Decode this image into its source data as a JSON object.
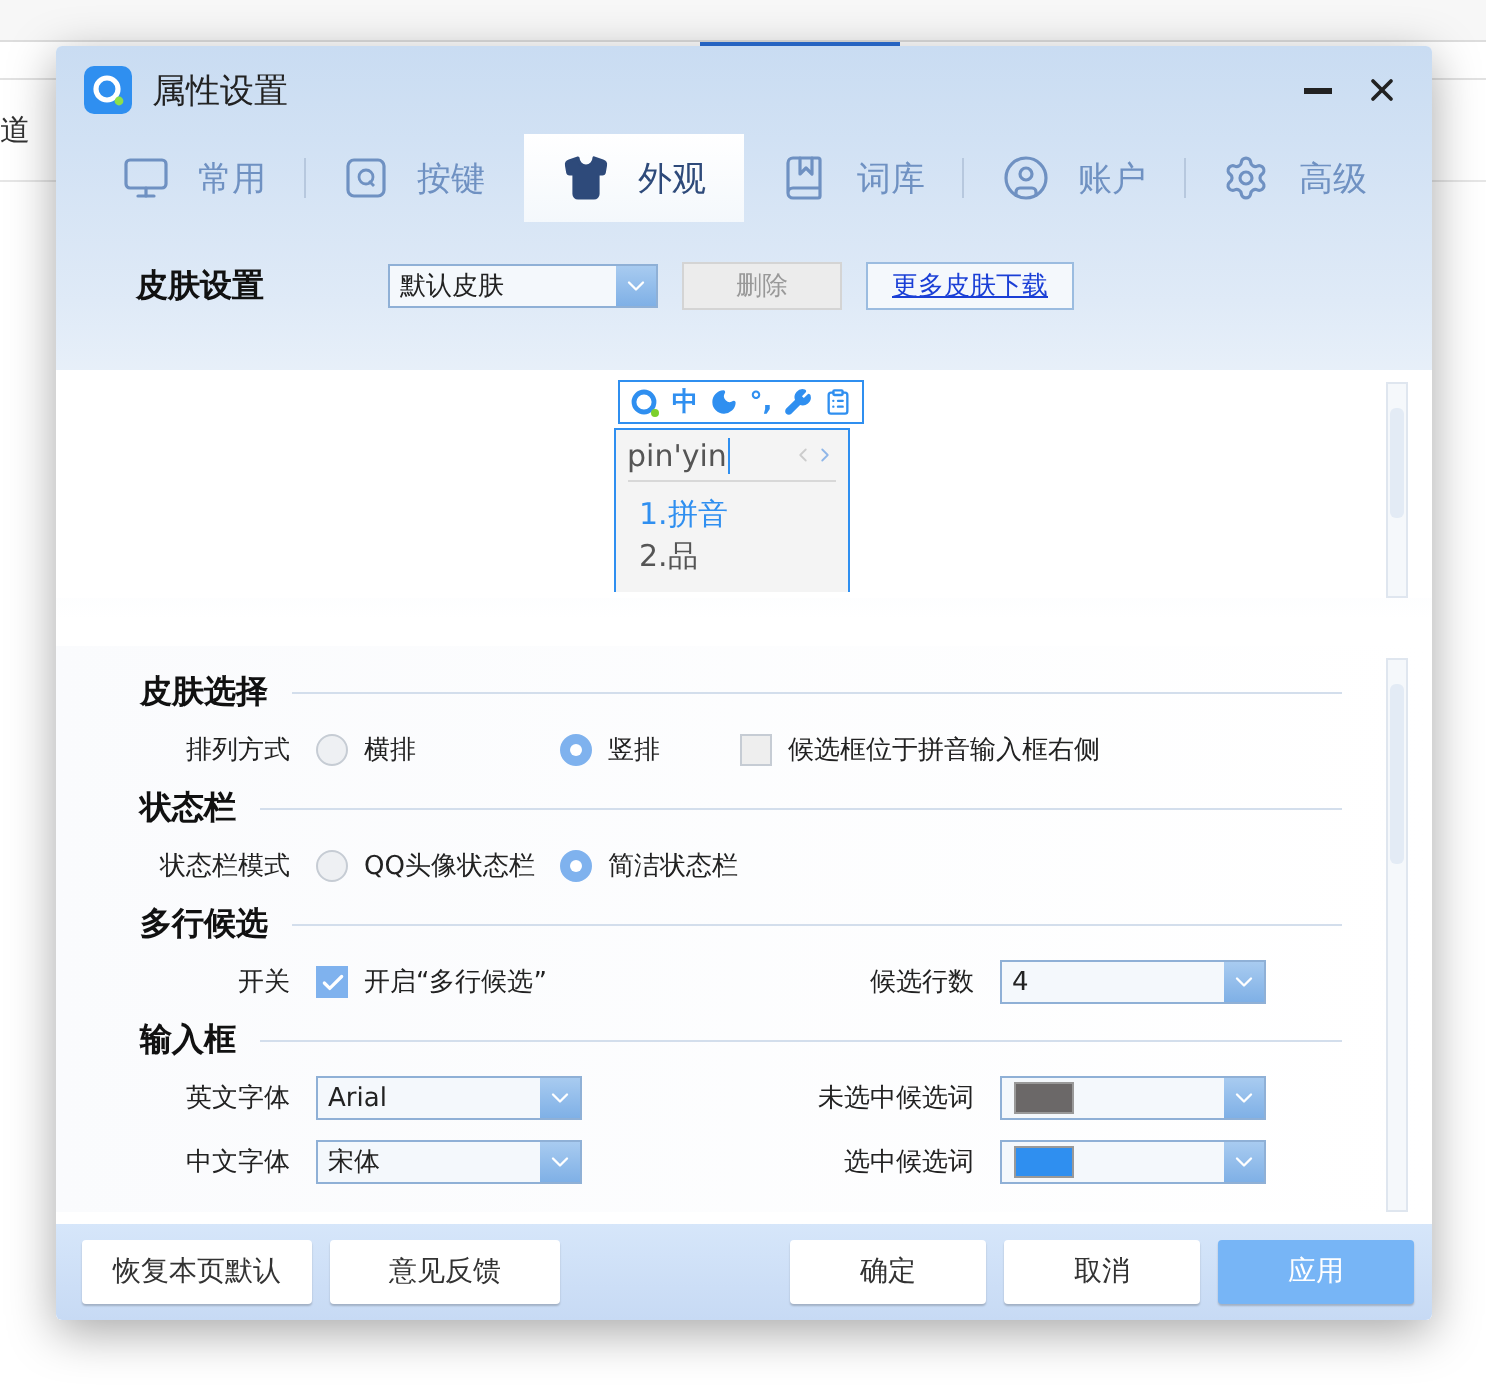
{
  "background": {
    "side_text": "道"
  },
  "window": {
    "title": "属性设置"
  },
  "tabs": [
    {
      "label": "常用",
      "selected": false
    },
    {
      "label": "按键",
      "selected": false
    },
    {
      "label": "外观",
      "selected": true
    },
    {
      "label": "词库",
      "selected": false
    },
    {
      "label": "账户",
      "selected": false
    },
    {
      "label": "高级",
      "selected": false
    }
  ],
  "skin": {
    "label": "皮肤设置",
    "select_value": "默认皮肤",
    "delete_button": {
      "label": "删除",
      "disabled": true
    },
    "more_link": "更多皮肤下载"
  },
  "preview": {
    "toolbar": [
      {
        "kind": "logo"
      },
      {
        "kind": "text",
        "text": "中"
      },
      {
        "kind": "moon"
      },
      {
        "kind": "text",
        "text": "°,"
      },
      {
        "kind": "wrench"
      },
      {
        "kind": "clipboard"
      }
    ],
    "input": "pin'yin",
    "candidates": [
      {
        "text": "1.拼音",
        "selected": true
      },
      {
        "text": "2.品",
        "selected": false
      }
    ]
  },
  "sections": [
    {
      "title": "皮肤选择",
      "rows": [
        {
          "label": "排列方式",
          "left": [
            {
              "kind": "radio",
              "text": "横排",
              "selected": false
            },
            {
              "kind": "radio",
              "text": "竖排",
              "selected": true
            },
            {
              "kind": "checkbox",
              "text": "候选框位于拼音输入框右侧",
              "checked": false
            }
          ]
        }
      ]
    },
    {
      "title": "状态栏",
      "rows": [
        {
          "label": "状态栏模式",
          "left": [
            {
              "kind": "radio",
              "text": "QQ头像状态栏",
              "selected": false
            },
            {
              "kind": "radio",
              "text": "简洁状态栏",
              "selected": true
            }
          ]
        }
      ]
    },
    {
      "title": "多行候选",
      "rows": [
        {
          "label": "开关",
          "left": [
            {
              "kind": "checkbox",
              "text": "开启“多行候选”",
              "checked": true
            }
          ],
          "right_label": "候选行数",
          "right": {
            "kind": "select",
            "value": "4"
          }
        }
      ]
    },
    {
      "title": "输入框",
      "rows": [
        {
          "label": "英文字体",
          "left": [
            {
              "kind": "select",
              "value": "Arial"
            }
          ],
          "right_label": "未选中候选词",
          "right": {
            "kind": "color",
            "color": "#6b6868"
          }
        },
        {
          "label": "中文字体",
          "left": [
            {
              "kind": "select",
              "value": "宋体"
            }
          ],
          "right_label": "选中候选词",
          "right": {
            "kind": "color",
            "color": "#2f8ff0"
          }
        }
      ]
    }
  ],
  "footer": {
    "left_buttons": [
      {
        "label": "恢复本页默认"
      },
      {
        "label": "意见反馈"
      }
    ],
    "right_buttons": [
      {
        "label": "确定",
        "kind": "default"
      },
      {
        "label": "取消",
        "kind": "default"
      },
      {
        "label": "应用",
        "kind": "primary"
      }
    ]
  }
}
